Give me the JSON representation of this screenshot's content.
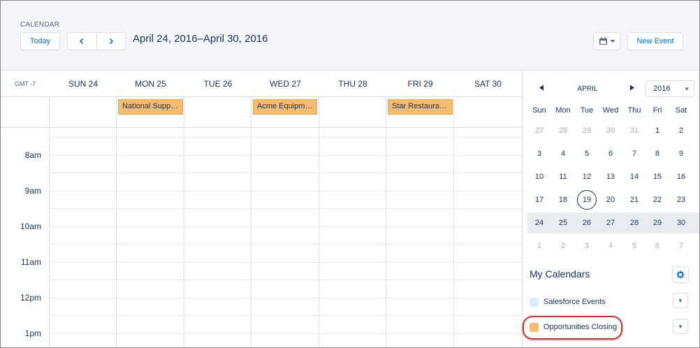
{
  "header": {
    "eyebrow": "CALENDAR",
    "today_label": "Today",
    "prev_icon": "chevron-left-icon",
    "next_icon": "chevron-right-icon",
    "date_range": "April 24, 2016–April 30, 2016",
    "calview_icon": "calendar-icon",
    "new_event_label": "New Event"
  },
  "week": {
    "timezone": "GMT -7",
    "days": [
      "SUN 24",
      "MON 25",
      "TUE 26",
      "WED 27",
      "THU 28",
      "FRI 29",
      "SAT 30"
    ],
    "times": [
      "8am",
      "9am",
      "10am",
      "11am",
      "12pm",
      "1pm"
    ],
    "events": [
      {
        "day_index": 1,
        "label": "National Supply ..."
      },
      {
        "day_index": 3,
        "label": "Acme Equipment"
      },
      {
        "day_index": 5,
        "label": "Star Restaurant ..."
      }
    ]
  },
  "mini_calendar": {
    "month": "APRIL",
    "year": "2016",
    "weekdays": [
      "Sun",
      "Mon",
      "Tue",
      "Wed",
      "Thu",
      "Fri",
      "Sat"
    ],
    "weeks": [
      [
        {
          "d": "27",
          "muted": true
        },
        {
          "d": "28",
          "muted": true
        },
        {
          "d": "29",
          "muted": true
        },
        {
          "d": "30",
          "muted": true
        },
        {
          "d": "31",
          "muted": true
        },
        {
          "d": "1"
        },
        {
          "d": "2"
        }
      ],
      [
        {
          "d": "3"
        },
        {
          "d": "4"
        },
        {
          "d": "5"
        },
        {
          "d": "6"
        },
        {
          "d": "7"
        },
        {
          "d": "8"
        },
        {
          "d": "9"
        }
      ],
      [
        {
          "d": "10"
        },
        {
          "d": "11"
        },
        {
          "d": "12"
        },
        {
          "d": "13"
        },
        {
          "d": "14"
        },
        {
          "d": "15"
        },
        {
          "d": "16"
        }
      ],
      [
        {
          "d": "17"
        },
        {
          "d": "18"
        },
        {
          "d": "19",
          "today": true
        },
        {
          "d": "20"
        },
        {
          "d": "21"
        },
        {
          "d": "22"
        },
        {
          "d": "23"
        }
      ],
      [
        {
          "d": "24"
        },
        {
          "d": "25"
        },
        {
          "d": "26"
        },
        {
          "d": "27"
        },
        {
          "d": "28"
        },
        {
          "d": "29"
        },
        {
          "d": "30"
        }
      ],
      [
        {
          "d": "1",
          "muted": true
        },
        {
          "d": "2",
          "muted": true
        },
        {
          "d": "3",
          "muted": true
        },
        {
          "d": "4",
          "muted": true
        },
        {
          "d": "5",
          "muted": true
        },
        {
          "d": "6",
          "muted": true
        },
        {
          "d": "7",
          "muted": true
        }
      ]
    ],
    "selected_week_index": 4
  },
  "my_calendars": {
    "title": "My Calendars",
    "settings_icon": "gear-icon",
    "items": [
      {
        "label": "Salesforce Events",
        "color": "#d8edff"
      },
      {
        "label": "Opportunities Closing",
        "color": "#f4bc6c"
      }
    ]
  },
  "colors": {
    "accent": "#0070d2",
    "event": "#f4bc6c",
    "highlight": "#d0342c"
  }
}
